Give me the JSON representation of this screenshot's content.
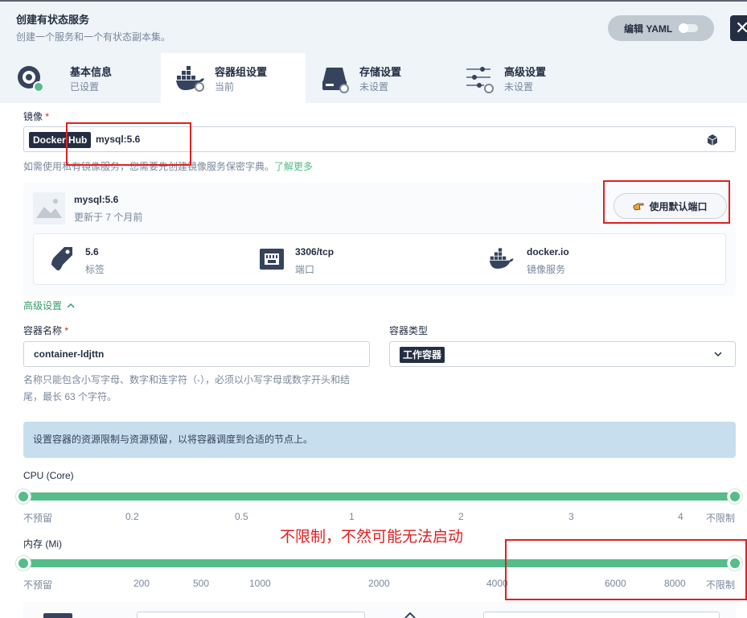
{
  "header": {
    "title": "创建有状态服务",
    "description": "创建一个服务和一个有状态副本集。",
    "yaml_label": "编辑 YAML",
    "close_glyph": "✕"
  },
  "tabs": [
    {
      "title": "基本信息",
      "status": "已设置"
    },
    {
      "title": "容器组设置",
      "status": "当前"
    },
    {
      "title": "存储设置",
      "status": "未设置"
    },
    {
      "title": "高级设置",
      "status": "未设置"
    }
  ],
  "image": {
    "label": "镜像",
    "required_mark": "*",
    "registry_tag": "Docker Hub",
    "value": "mysql:5.6",
    "hint": "如需使用私有镜像服务，您需要先创建镜像服务保密字典。",
    "hint_link": "了解更多"
  },
  "image_card": {
    "name": "mysql:5.6",
    "updated": "更新于 7 个月前",
    "default_port_button": "使用默认端口",
    "details": [
      {
        "value": "5.6",
        "label": "标签",
        "icon": "tag-icon"
      },
      {
        "value": "3306/tcp",
        "label": "端口",
        "icon": "port-icon"
      },
      {
        "value": "docker.io",
        "label": "镜像服务",
        "icon": "docker-icon"
      }
    ]
  },
  "advanced_toggle": "高级设置",
  "container_name": {
    "label": "容器名称",
    "required_mark": "*",
    "value": "container-ldjttn",
    "hint_line1": "名称只能包含小写字母、数字和连字符（-），必须以小写字母或数字开头和结",
    "hint_line2": "尾，最长 63 个字符。"
  },
  "container_type": {
    "label": "容器类型",
    "value": "工作容器"
  },
  "resource_info": "设置容器的资源限制与资源预留，以将容器调度到合适的节点上。",
  "cpu": {
    "label": "CPU (Core)",
    "ticks": [
      "不预留",
      "0.2",
      "0.5",
      "1",
      "2",
      "3",
      "4",
      "不限制"
    ],
    "range": [
      "不预留",
      "不限制"
    ]
  },
  "memory": {
    "label": "内存 (Mi)",
    "ticks": [
      "不预留",
      "200",
      "500",
      "1000",
      "2000",
      "4000",
      "6000",
      "8000",
      "不限制"
    ],
    "range": [
      "不预留",
      "不限制"
    ]
  },
  "annotation": "不限制，不然可能无法启动",
  "colors": {
    "accent": "#55bc8a",
    "dark": "#242e42",
    "annotation": "#e02020"
  }
}
